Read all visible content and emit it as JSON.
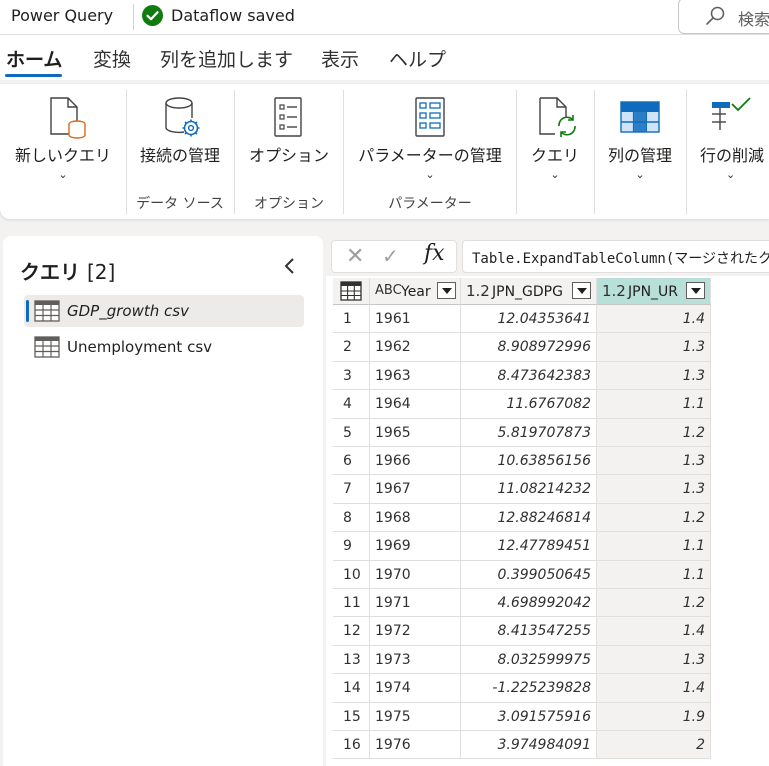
{
  "app": {
    "title": "Power Query",
    "status": "Dataflow saved",
    "search_placeholder": "検索",
    "accent_color": "#0f6cbd",
    "status_color": "#107c10"
  },
  "tabs": [
    {
      "label": "ホーム",
      "active": true
    },
    {
      "label": "変換",
      "active": false
    },
    {
      "label": "列を追加します",
      "active": false
    },
    {
      "label": "表示",
      "active": false
    },
    {
      "label": "ヘルプ",
      "active": false
    }
  ],
  "ribbon": {
    "new_query": "新しいクエリ",
    "manage_connections": "接続の管理",
    "options": "オプション",
    "manage_parameters": "パラメーターの管理",
    "query": "クエリ",
    "manage_columns": "列の管理",
    "reduce_rows": "行の削減",
    "groups": {
      "data_sources": "データ ソース",
      "options": "オプション",
      "parameters": "パラメーター"
    }
  },
  "queries_pane": {
    "title": "クエリ",
    "count": "[2]",
    "items": [
      {
        "label": "GDP_growth csv",
        "selected": true
      },
      {
        "label": "Unemployment csv",
        "selected": false
      }
    ]
  },
  "formula_bar": {
    "fx": "fx",
    "formula": "Table.ExpandTableColumn(マージされたクエリ"
  },
  "table": {
    "columns": [
      {
        "type": "ABC",
        "name": "Year"
      },
      {
        "type": "1.2",
        "name": "JPN_GDPG"
      },
      {
        "type": "1.2",
        "name": "JPN_UR"
      }
    ],
    "rows": [
      {
        "n": "1",
        "year": "1961",
        "gdp": "12.04353641",
        "ur": "1.4"
      },
      {
        "n": "2",
        "year": "1962",
        "gdp": "8.908972996",
        "ur": "1.3"
      },
      {
        "n": "3",
        "year": "1963",
        "gdp": "8.473642383",
        "ur": "1.3"
      },
      {
        "n": "4",
        "year": "1964",
        "gdp": "11.6767082",
        "ur": "1.1"
      },
      {
        "n": "5",
        "year": "1965",
        "gdp": "5.819707873",
        "ur": "1.2"
      },
      {
        "n": "6",
        "year": "1966",
        "gdp": "10.63856156",
        "ur": "1.3"
      },
      {
        "n": "7",
        "year": "1967",
        "gdp": "11.08214232",
        "ur": "1.3"
      },
      {
        "n": "8",
        "year": "1968",
        "gdp": "12.88246814",
        "ur": "1.2"
      },
      {
        "n": "9",
        "year": "1969",
        "gdp": "12.47789451",
        "ur": "1.1"
      },
      {
        "n": "10",
        "year": "1970",
        "gdp": "0.399050645",
        "ur": "1.1"
      },
      {
        "n": "11",
        "year": "1971",
        "gdp": "4.698992042",
        "ur": "1.2"
      },
      {
        "n": "12",
        "year": "1972",
        "gdp": "8.413547255",
        "ur": "1.4"
      },
      {
        "n": "13",
        "year": "1973",
        "gdp": "8.032599975",
        "ur": "1.3"
      },
      {
        "n": "14",
        "year": "1974",
        "gdp": "-1.225239828",
        "ur": "1.4"
      },
      {
        "n": "15",
        "year": "1975",
        "gdp": "3.091575916",
        "ur": "1.9"
      },
      {
        "n": "16",
        "year": "1976",
        "gdp": "3.974984091",
        "ur": "2"
      }
    ]
  }
}
